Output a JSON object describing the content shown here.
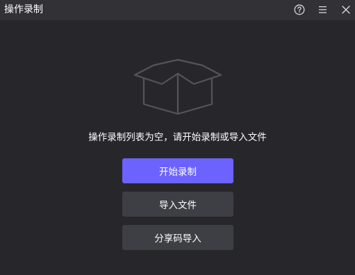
{
  "window": {
    "title": "操作录制"
  },
  "titlebar": {
    "help_icon": "question-circle-icon",
    "menu_icon": "hamburger-menu-icon",
    "close_icon": "close-x-icon"
  },
  "empty_state": {
    "illustration_icon": "open-box-icon",
    "message": "操作录制列表为空，请开始录制或导入文件"
  },
  "actions": {
    "start_label": "开始录制",
    "import_label": "导入文件",
    "share_code_label": "分享码导入"
  },
  "colors": {
    "background": "#27272b",
    "titlebar": "#323236",
    "primary_button": "#6c63ff",
    "secondary_button": "#3e3e45"
  }
}
